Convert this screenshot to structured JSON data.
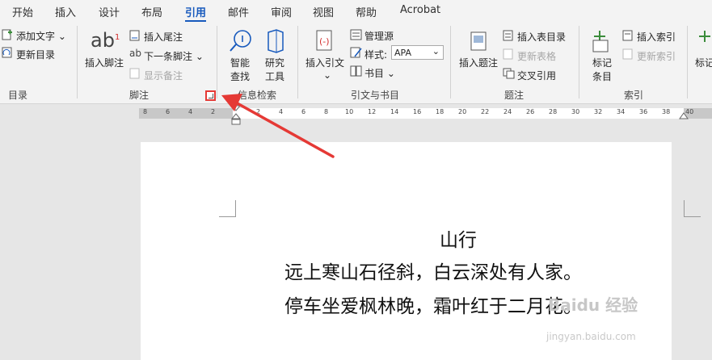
{
  "tabs": [
    "开始",
    "插入",
    "设计",
    "布局",
    "引用",
    "邮件",
    "审阅",
    "视图",
    "帮助",
    "Acrobat"
  ],
  "active_tab_index": 4,
  "ribbon": {
    "toc": {
      "add_text": "添加文字",
      "update_toc": "更新目录",
      "group": "目录"
    },
    "footnotes": {
      "insert_footnote": "插入脚注",
      "insert_endnote": "插入尾注",
      "next_footnote": "下一条脚注",
      "show_notes": "显示备注",
      "group": "脚注",
      "ab_glyph": "ab",
      "ab_super": "1"
    },
    "research": {
      "smart_lookup": "智能查找",
      "smart_lookup_1": "智能",
      "smart_lookup_2": "查找",
      "researcher_1": "研究",
      "researcher_2": "工具",
      "group": "信息检索"
    },
    "citations": {
      "insert_citation": "插入引文",
      "manage_sources": "管理源",
      "style_label": "样式:",
      "style_value": "APA",
      "bibliography": "书目",
      "group": "引文与书目"
    },
    "captions": {
      "insert_caption": "插入题注",
      "insert_table_of_figures": "插入表目录",
      "update_table": "更新表格",
      "cross_reference": "交叉引用",
      "group": "题注"
    },
    "index": {
      "mark_entry_1": "标记",
      "mark_entry_2": "条目",
      "insert_index": "插入索引",
      "update_index": "更新索引",
      "group": "索引",
      "mark_citation": "标记"
    }
  },
  "ruler_ticks": [
    "8",
    "6",
    "4",
    "2",
    "2",
    "4",
    "6",
    "8",
    "10",
    "12",
    "14",
    "16",
    "18",
    "20",
    "22",
    "24",
    "26",
    "28",
    "30",
    "32",
    "34",
    "36",
    "38",
    "40"
  ],
  "document": {
    "title": "山行",
    "line1": "远上寒山石径斜，白云深处有人家。",
    "line2": "停车坐爱枫林晚，霜叶红于二月花。"
  },
  "watermark": {
    "brand": "Baidu 经验",
    "url": "jingyan.baidu.com"
  },
  "colors": {
    "accent": "#185abd",
    "highlight": "#e53935",
    "icon_green": "#3b8c3b"
  }
}
